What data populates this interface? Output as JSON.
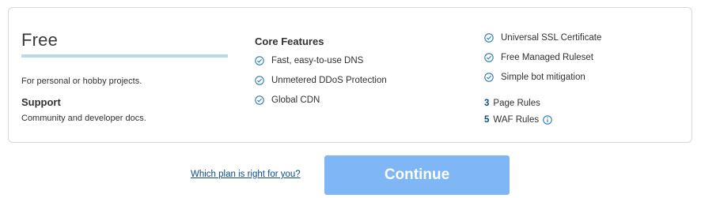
{
  "plan": {
    "name": "Free",
    "description": "For personal or hobby projects.",
    "support_title": "Support",
    "support_description": "Community and developer docs."
  },
  "core_features": {
    "title": "Core Features",
    "items": [
      "Fast, easy-to-use DNS",
      "Unmetered DDoS Protection",
      "Global CDN"
    ]
  },
  "extra_features": {
    "items": [
      "Universal SSL Certificate",
      "Free Managed Ruleset",
      "Simple bot mitigation"
    ]
  },
  "rules": [
    {
      "count": "3",
      "label": "Page Rules"
    },
    {
      "count": "5",
      "label": "WAF Rules"
    }
  ],
  "icons": {
    "check": "check-circle-icon",
    "info": "info-icon"
  },
  "colors": {
    "accent_link": "#0b4d8c",
    "check": "#2c7cb0",
    "underline": "#b8d9ec",
    "button": "#7fb6f5"
  },
  "actions": {
    "help_link": "Which plan is right for you?",
    "continue_label": "Continue"
  }
}
